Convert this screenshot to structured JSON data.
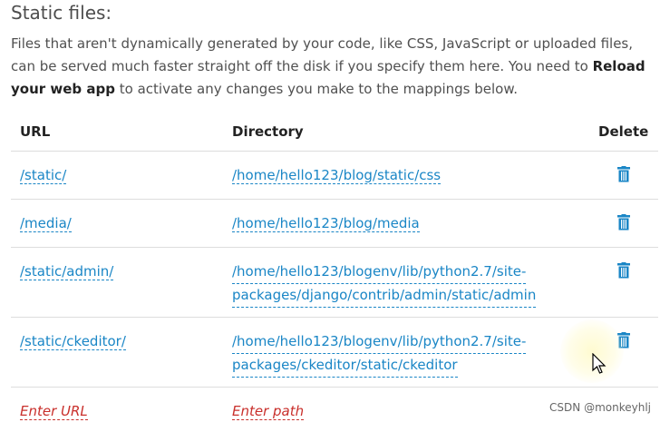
{
  "section": {
    "title": "Static files:",
    "desc_part1": "Files that aren't dynamically generated by your code, like CSS, JavaScript or uploaded files, can be served much faster straight off the disk if you specify them here. You need to",
    "desc_bold": "Reload your web app",
    "desc_part2": "to activate any changes you make to the mappings below."
  },
  "table": {
    "headers": {
      "url": "URL",
      "directory": "Directory",
      "delete": "Delete"
    },
    "rows": [
      {
        "url": "/static/",
        "dir_line1": "/home/hello123/blog/static/css",
        "dir_line2": ""
      },
      {
        "url": "/media/",
        "dir_line1": "/home/hello123/blog/media",
        "dir_line2": ""
      },
      {
        "url": "/static/admin/",
        "dir_line1": "/home/hello123/blogenv/lib/python2.7/site-",
        "dir_line2": "packages/django/contrib/admin/static/admin"
      },
      {
        "url": "/static/ckeditor/",
        "dir_line1": "/home/hello123/blogenv/lib/python2.7/site-",
        "dir_line2": "packages/ckeditor/static/ckeditor"
      }
    ],
    "new_row": {
      "url_placeholder": "Enter URL",
      "path_placeholder": "Enter path"
    }
  },
  "watermark": "CSDN @monkeyhlj",
  "icons": {
    "delete": "trash-icon",
    "cursor": "mouse-pointer-icon"
  },
  "colors": {
    "link": "#1a86c6",
    "placeholder": "#c9302c"
  }
}
